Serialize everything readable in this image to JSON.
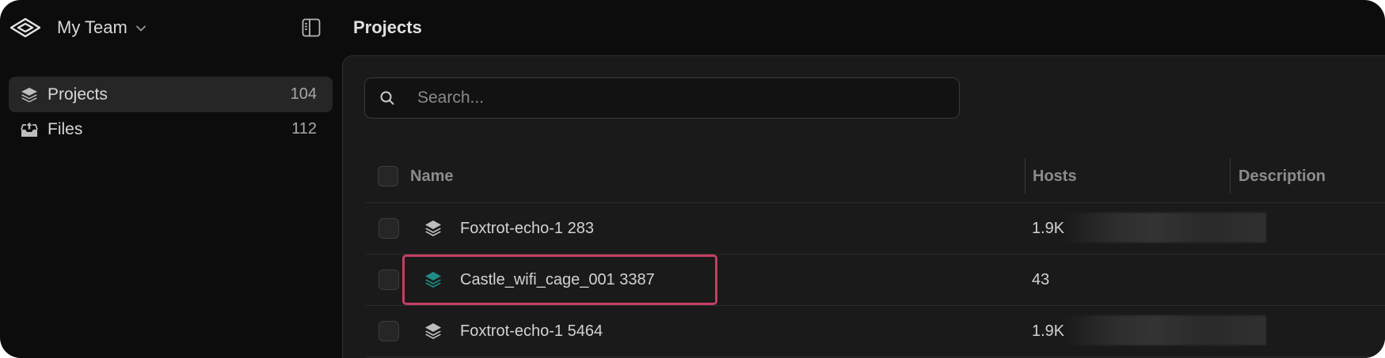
{
  "header": {
    "team_name": "My Team",
    "page_title": "Projects"
  },
  "sidebar": {
    "items": [
      {
        "label": "Projects",
        "count": "104",
        "icon": "layers-icon",
        "active": true
      },
      {
        "label": "Files",
        "count": "112",
        "icon": "inbox-upload-icon",
        "active": false
      }
    ]
  },
  "search": {
    "placeholder": "Search...",
    "value": ""
  },
  "table": {
    "columns": [
      "Name",
      "Hosts",
      "Description"
    ],
    "rows": [
      {
        "name": "Foxtrot-echo-1 283",
        "hosts": "1.9K",
        "icon": "layers-icon",
        "icon_color": "#bdbdbd",
        "description": ""
      },
      {
        "name": "Castle_wifi_cage_001 3387",
        "hosts": "43",
        "icon": "layers-icon",
        "icon_color": "#1e8c84",
        "description": ""
      },
      {
        "name": "Foxtrot-echo-1 5464",
        "hosts": "1.9K",
        "icon": "layers-icon",
        "icon_color": "#bdbdbd",
        "description": ""
      }
    ]
  },
  "colors": {
    "background": "#0c0c0c",
    "panel": "#1a1a1a",
    "highlight": "#c53f62",
    "teal_accent": "#1e8c84"
  }
}
